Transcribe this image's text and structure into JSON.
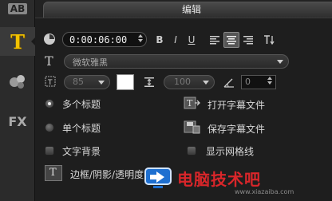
{
  "tab": {
    "title": "编辑"
  },
  "sidebar": {
    "items": [
      {
        "name": "ab",
        "label": "AB"
      },
      {
        "name": "title",
        "label": "T"
      },
      {
        "name": "effects",
        "label": ""
      },
      {
        "name": "fx",
        "label": "FX"
      }
    ]
  },
  "timecode": {
    "value": "0:00:06:00"
  },
  "format": {
    "bold": "B",
    "italic": "I",
    "underline": "U"
  },
  "font": {
    "family": "微软雅黑"
  },
  "size": {
    "value": "85"
  },
  "line_spacing": {
    "value": "100"
  },
  "angle": {
    "value": "0"
  },
  "options": {
    "multi_title": "多个标题",
    "single_title": "单个标题",
    "text_background": "文字背景",
    "border_shadow": "边框/阴影/透明度",
    "open_subtitle": "打开字幕文件",
    "save_subtitle": "保存字幕文件",
    "show_grid": "显示网格线"
  },
  "watermark": {
    "text": "电脑技术吧",
    "url": "www.xiazaiba.com"
  },
  "colors": {
    "accent": "#1e6fd0",
    "watermark_red": "#d9262a"
  }
}
